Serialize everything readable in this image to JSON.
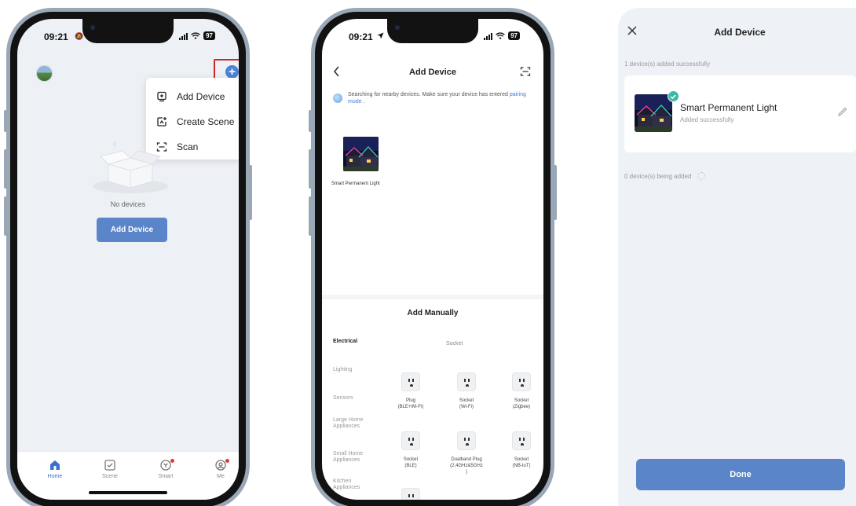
{
  "phone1": {
    "status": {
      "time": "09:21",
      "battery": "97"
    },
    "menu": [
      {
        "label": "Add Device",
        "icon": "add-device-icon"
      },
      {
        "label": "Create Scene",
        "icon": "create-scene-icon"
      },
      {
        "label": "Scan",
        "icon": "scan-icon"
      }
    ],
    "empty_text": "No devices",
    "add_button": "Add Device",
    "tabs": [
      {
        "label": "Home",
        "icon": "home-icon",
        "active": true
      },
      {
        "label": "Scene",
        "icon": "scene-icon"
      },
      {
        "label": "Smart",
        "icon": "smart-icon",
        "badge": true
      },
      {
        "label": "Me",
        "icon": "me-icon",
        "badge": true
      }
    ],
    "colors": {
      "accent": "#4e82d4",
      "highlight": "#d3262a"
    }
  },
  "phone2": {
    "status": {
      "time": "09:21",
      "battery": "97"
    },
    "title": "Add Device",
    "search_text": "Searching for nearby devices. Make sure your device has entered",
    "search_link": "pairing mode",
    "search_suffix": ".",
    "found_device": "Smart Permanent Light",
    "manual_title": "Add Manually",
    "categories": [
      "Electrical",
      "Lighting",
      "Sensors",
      "Large Home Appliances",
      "Small Home Appliances",
      "Kitchen Appliances"
    ],
    "subcategory": "Socket",
    "grid": [
      {
        "name": "Plug",
        "detail": "(BLE+Wi-Fi)"
      },
      {
        "name": "Socket",
        "detail": "(Wi-Fi)"
      },
      {
        "name": "Socket",
        "detail": "(Zigbee)"
      },
      {
        "name": "Socket",
        "detail": "(BLE)"
      },
      {
        "name": "Dualband Plug",
        "detail": "(2.4GHz&5GHz",
        "detail2": ")"
      },
      {
        "name": "Socket",
        "detail": "(NB-IoT)"
      }
    ]
  },
  "panel3": {
    "title": "Add Device",
    "added_text": "1 device(s) added successfully",
    "device_name": "Smart Permanent Light",
    "device_status": "Added successfully",
    "adding_text": "0 device(s) being added",
    "done": "Done",
    "colors": {
      "success": "#3bb8a6",
      "button": "#5a86c9"
    }
  }
}
